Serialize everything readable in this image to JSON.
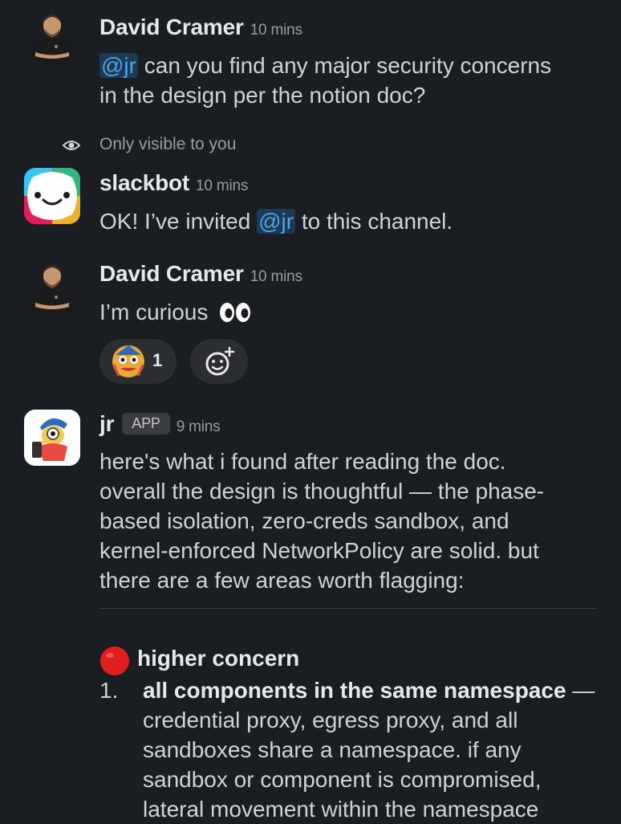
{
  "messages": [
    {
      "author": "David Cramer",
      "time": "10 mins",
      "mention": "@jr",
      "text_line1": " can you find any major security concerns",
      "text_line2": "in the design per the notion doc?"
    },
    {
      "visibility_note": "Only visible to you",
      "author": "slackbot",
      "time": "10 mins",
      "text_pre": "OK! I’ve invited ",
      "mention": "@jr",
      "text_post": " to this channel."
    },
    {
      "author": "David Cramer",
      "time": "10 mins",
      "text": "I’m curious",
      "reaction_count": "1"
    },
    {
      "author": "jr",
      "badge": "APP",
      "time": "9 mins",
      "lines": [
        "here's what i found after reading the doc.",
        "overall the design is thoughtful — the phase-",
        "based isolation, zero-creds sandbox, and",
        "kernel-enforced NetworkPolicy are solid. but",
        "there are a few areas worth flagging:"
      ],
      "section_heading": "higher concern",
      "list_number": "1.",
      "list_item_title": "all components in the same namespace",
      "list_item_dash": " —",
      "list_item_lines": [
        "credential proxy, egress proxy, and all",
        "sandboxes share a namespace. if any",
        "sandbox or component is compromised,",
        "lateral movement within the namespace"
      ]
    }
  ],
  "colors": {
    "background": "#1a1d21",
    "mention_bg": "#1d3a52",
    "mention_fg": "#4ba3e3",
    "red_circle": "#e01e1e"
  }
}
